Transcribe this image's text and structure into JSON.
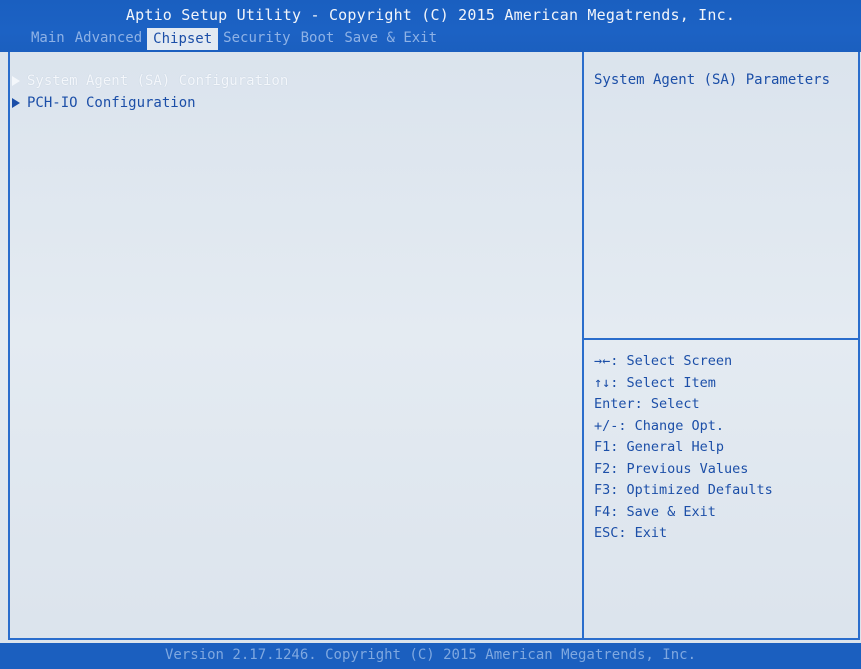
{
  "header": {
    "title": "Aptio Setup Utility - Copyright (C) 2015 American Megatrends, Inc.",
    "tabs": [
      {
        "label": "Main",
        "active": false
      },
      {
        "label": "Advanced",
        "active": false
      },
      {
        "label": "Chipset",
        "active": true
      },
      {
        "label": "Security",
        "active": false
      },
      {
        "label": "Boot",
        "active": false
      },
      {
        "label": "Save & Exit",
        "active": false
      }
    ]
  },
  "main": {
    "items": [
      {
        "label": "System Agent (SA) Configuration",
        "icon": "right-triangle-icon",
        "selected": true
      },
      {
        "label": "PCH-IO Configuration",
        "icon": "right-triangle-icon",
        "selected": false
      }
    ]
  },
  "help": {
    "description": "System Agent (SA) Parameters",
    "keys": [
      "→←: Select Screen",
      "↑↓: Select Item",
      "Enter: Select",
      "+/-: Change Opt.",
      "F1: General Help",
      "F2: Previous Values",
      "F3: Optimized Defaults",
      "F4: Save & Exit",
      "ESC: Exit"
    ]
  },
  "footer": {
    "text": "Version 2.17.1246. Copyright (C) 2015 American Megatrends, Inc."
  },
  "colors": {
    "header_bg": "#1b5fbf",
    "body_bg": "#dfe6ee",
    "text_blue": "#1c4fa8",
    "highlight_text": "#f4f7fb",
    "inactive_tab": "#8eb2e6"
  }
}
